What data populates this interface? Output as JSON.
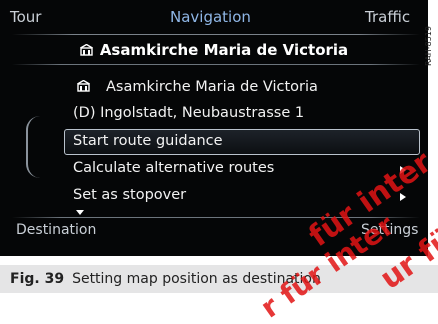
{
  "tabs": {
    "left": "Tour",
    "center": "Navigation",
    "right": "Traffic"
  },
  "header": {
    "title": "Asamkirche Maria de Victoria",
    "icon": "building-icon"
  },
  "destination": {
    "name": "Asamkirche Maria de Victoria",
    "address": "(D) Ingolstadt, Neubaustrasse 1"
  },
  "menu": [
    {
      "label": "Start route guidance"
    },
    {
      "label": "Calculate alternative routes"
    },
    {
      "label": "Set as stopover"
    }
  ],
  "footer": {
    "left": "Destination",
    "right": "Settings"
  },
  "side_code": "RAH-8519",
  "caption": {
    "figure": "Fig. 39",
    "text": "Setting map position as destination"
  },
  "watermark": {
    "line1": "für inter",
    "line2": "ur für intern",
    "line3": "r für inter"
  },
  "colors": {
    "screen_bg": "#050607",
    "active_tab": "#8fb6e6",
    "watermark": "#e21414"
  }
}
